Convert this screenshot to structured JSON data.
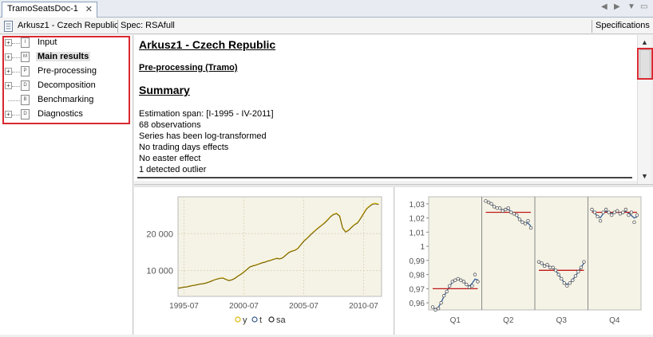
{
  "tab": {
    "title": "TramoSeatsDoc-1",
    "close": "✕"
  },
  "tab_controls": {
    "left": "◀",
    "right": "▶",
    "menu": "▼",
    "minimize": "▭"
  },
  "toolbar": {
    "doc_name": "Arkusz1 - Czech Republic",
    "spec": "Spec: RSAfull",
    "specifications": "Specifications"
  },
  "tree": {
    "items": [
      {
        "label": "Input",
        "icon_letter": "I",
        "expandable": true
      },
      {
        "label": "Main results",
        "icon_letter": "M",
        "expandable": true,
        "selected": true
      },
      {
        "label": "Pre-processing",
        "icon_letter": "P",
        "expandable": true
      },
      {
        "label": "Decomposition",
        "icon_letter": "D",
        "expandable": true
      },
      {
        "label": "Benchmarking",
        "icon_letter": "B",
        "expandable": false
      },
      {
        "label": "Diagnostics",
        "icon_letter": "D",
        "expandable": true
      }
    ]
  },
  "summary": {
    "title": "Arkusz1 - Czech Republic",
    "preprocessing": "Pre-processing (Tramo)",
    "heading": "Summary",
    "lines": [
      "Estimation span: [I-1995 - IV-2011]",
      "68 observations",
      "Series has been log-transformed",
      "No trading days effects",
      "No easter effect",
      "1 detected outlier"
    ]
  },
  "colors": {
    "highlight": "#d9282f",
    "series_y": "#e0b800",
    "series_t": "#3a5a8c",
    "series_sa": "#2a2a2a",
    "mean_line": "#c01818",
    "plot_bg": "#f5f3e6"
  },
  "chart_data": [
    {
      "type": "line",
      "x_tick_labels": [
        "1995-07",
        "2000-07",
        "2005-07",
        "2010-07"
      ],
      "y_tick_labels": [
        "10 000",
        "20 000"
      ],
      "xlim": [
        1995.0,
        2012.0
      ],
      "ylim": [
        3000,
        30000
      ],
      "grid": true,
      "legend": {
        "placement": "bottom",
        "items": [
          {
            "symbol": "o",
            "label": "y",
            "color": "#e0b800"
          },
          {
            "symbol": "o",
            "label": "t",
            "color": "#3a5a8c"
          },
          {
            "symbol": "o",
            "label": "sa",
            "color": "#2a2a2a"
          }
        ]
      },
      "x": [
        1995.0,
        1995.25,
        1995.5,
        1995.75,
        1996.0,
        1996.25,
        1996.5,
        1996.75,
        1997.0,
        1997.25,
        1997.5,
        1997.75,
        1998.0,
        1998.25,
        1998.5,
        1998.75,
        1999.0,
        1999.25,
        1999.5,
        1999.75,
        2000.0,
        2000.25,
        2000.5,
        2000.75,
        2001.0,
        2001.25,
        2001.5,
        2001.75,
        2002.0,
        2002.25,
        2002.5,
        2002.75,
        2003.0,
        2003.25,
        2003.5,
        2003.75,
        2004.0,
        2004.25,
        2004.5,
        2004.75,
        2005.0,
        2005.25,
        2005.5,
        2005.75,
        2006.0,
        2006.25,
        2006.5,
        2006.75,
        2007.0,
        2007.25,
        2007.5,
        2007.75,
        2008.0,
        2008.25,
        2008.5,
        2008.75,
        2009.0,
        2009.25,
        2009.5,
        2009.75,
        2010.0,
        2010.25,
        2010.5,
        2010.75,
        2011.0,
        2011.25,
        2011.5,
        2011.75
      ],
      "series": [
        {
          "name": "y",
          "values": [
            5200,
            5350,
            5500,
            5600,
            5800,
            5950,
            6100,
            6300,
            6400,
            6550,
            6800,
            7100,
            7450,
            7700,
            7900,
            8000,
            7600,
            7300,
            7500,
            7900,
            8500,
            9000,
            9600,
            10300,
            11000,
            11300,
            11500,
            11800,
            12100,
            12300,
            12600,
            12800,
            13100,
            13300,
            13200,
            13500,
            14200,
            14900,
            15300,
            15500,
            16000,
            17000,
            18000,
            18700,
            19500,
            20300,
            21000,
            21700,
            22300,
            23000,
            23800,
            24700,
            25300,
            25500,
            24800,
            21500,
            20500,
            21000,
            21800,
            22500,
            23000,
            24200,
            25500,
            26800,
            27500,
            28100,
            28200,
            28000
          ]
        }
      ]
    },
    {
      "type": "line",
      "categories": [
        "Q1",
        "Q2",
        "Q3",
        "Q4"
      ],
      "y_tick_labels": [
        "0,96",
        "0,97",
        "0,98",
        "0,99",
        "1",
        "1,01",
        "1,02",
        "1,03"
      ],
      "ylim": [
        0.955,
        1.035
      ],
      "seasonal_points": [
        [
          0.957,
          0.955,
          0.956,
          0.96,
          0.965,
          0.968,
          0.972,
          0.975,
          0.976,
          0.977,
          0.976,
          0.975,
          0.973,
          0.971,
          0.972,
          0.98,
          0.975
        ],
        [
          1.032,
          1.031,
          1.03,
          1.028,
          1.027,
          1.027,
          1.025,
          1.026,
          1.027,
          1.024,
          1.023,
          1.022,
          1.019,
          1.017,
          1.016,
          1.018,
          1.013
        ],
        [
          0.989,
          0.988,
          0.986,
          0.987,
          0.985,
          0.985,
          0.983,
          0.98,
          0.977,
          0.974,
          0.972,
          0.974,
          0.976,
          0.979,
          0.982,
          0.985,
          0.989
        ],
        [
          1.026,
          1.024,
          1.021,
          1.018,
          1.024,
          1.026,
          1.024,
          1.022,
          1.024,
          1.025,
          1.023,
          1.024,
          1.026,
          1.022,
          1.024,
          1.017,
          1.022
        ]
      ],
      "means": [
        0.97,
        1.024,
        0.983,
        1.024
      ]
    }
  ]
}
